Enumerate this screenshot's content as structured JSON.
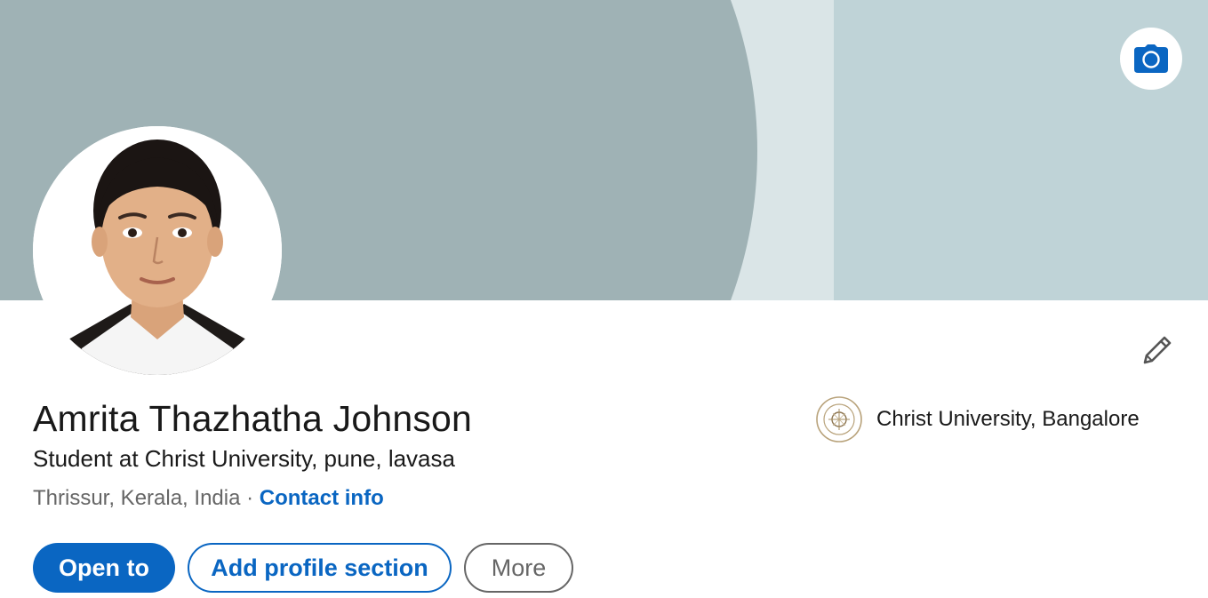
{
  "profile": {
    "name": "Amrita Thazhatha Johnson",
    "headline": "Student at Christ University, pune, lavasa",
    "location": "Thrissur, Kerala, India",
    "separator": " · ",
    "contact_link": "Contact info"
  },
  "education": {
    "school": "Christ University, Bangalore"
  },
  "actions": {
    "open_to": "Open to",
    "add_section": "Add profile section",
    "more": "More"
  },
  "icons": {
    "banner_camera": "camera-icon",
    "edit": "pencil-icon",
    "school_logo": "university-crest-icon"
  },
  "colors": {
    "brand_blue": "#0a66c2",
    "banner_dark": "#9fb2b5",
    "banner_light": "#bfd3d7",
    "banner_strip": "#dae5e7"
  }
}
